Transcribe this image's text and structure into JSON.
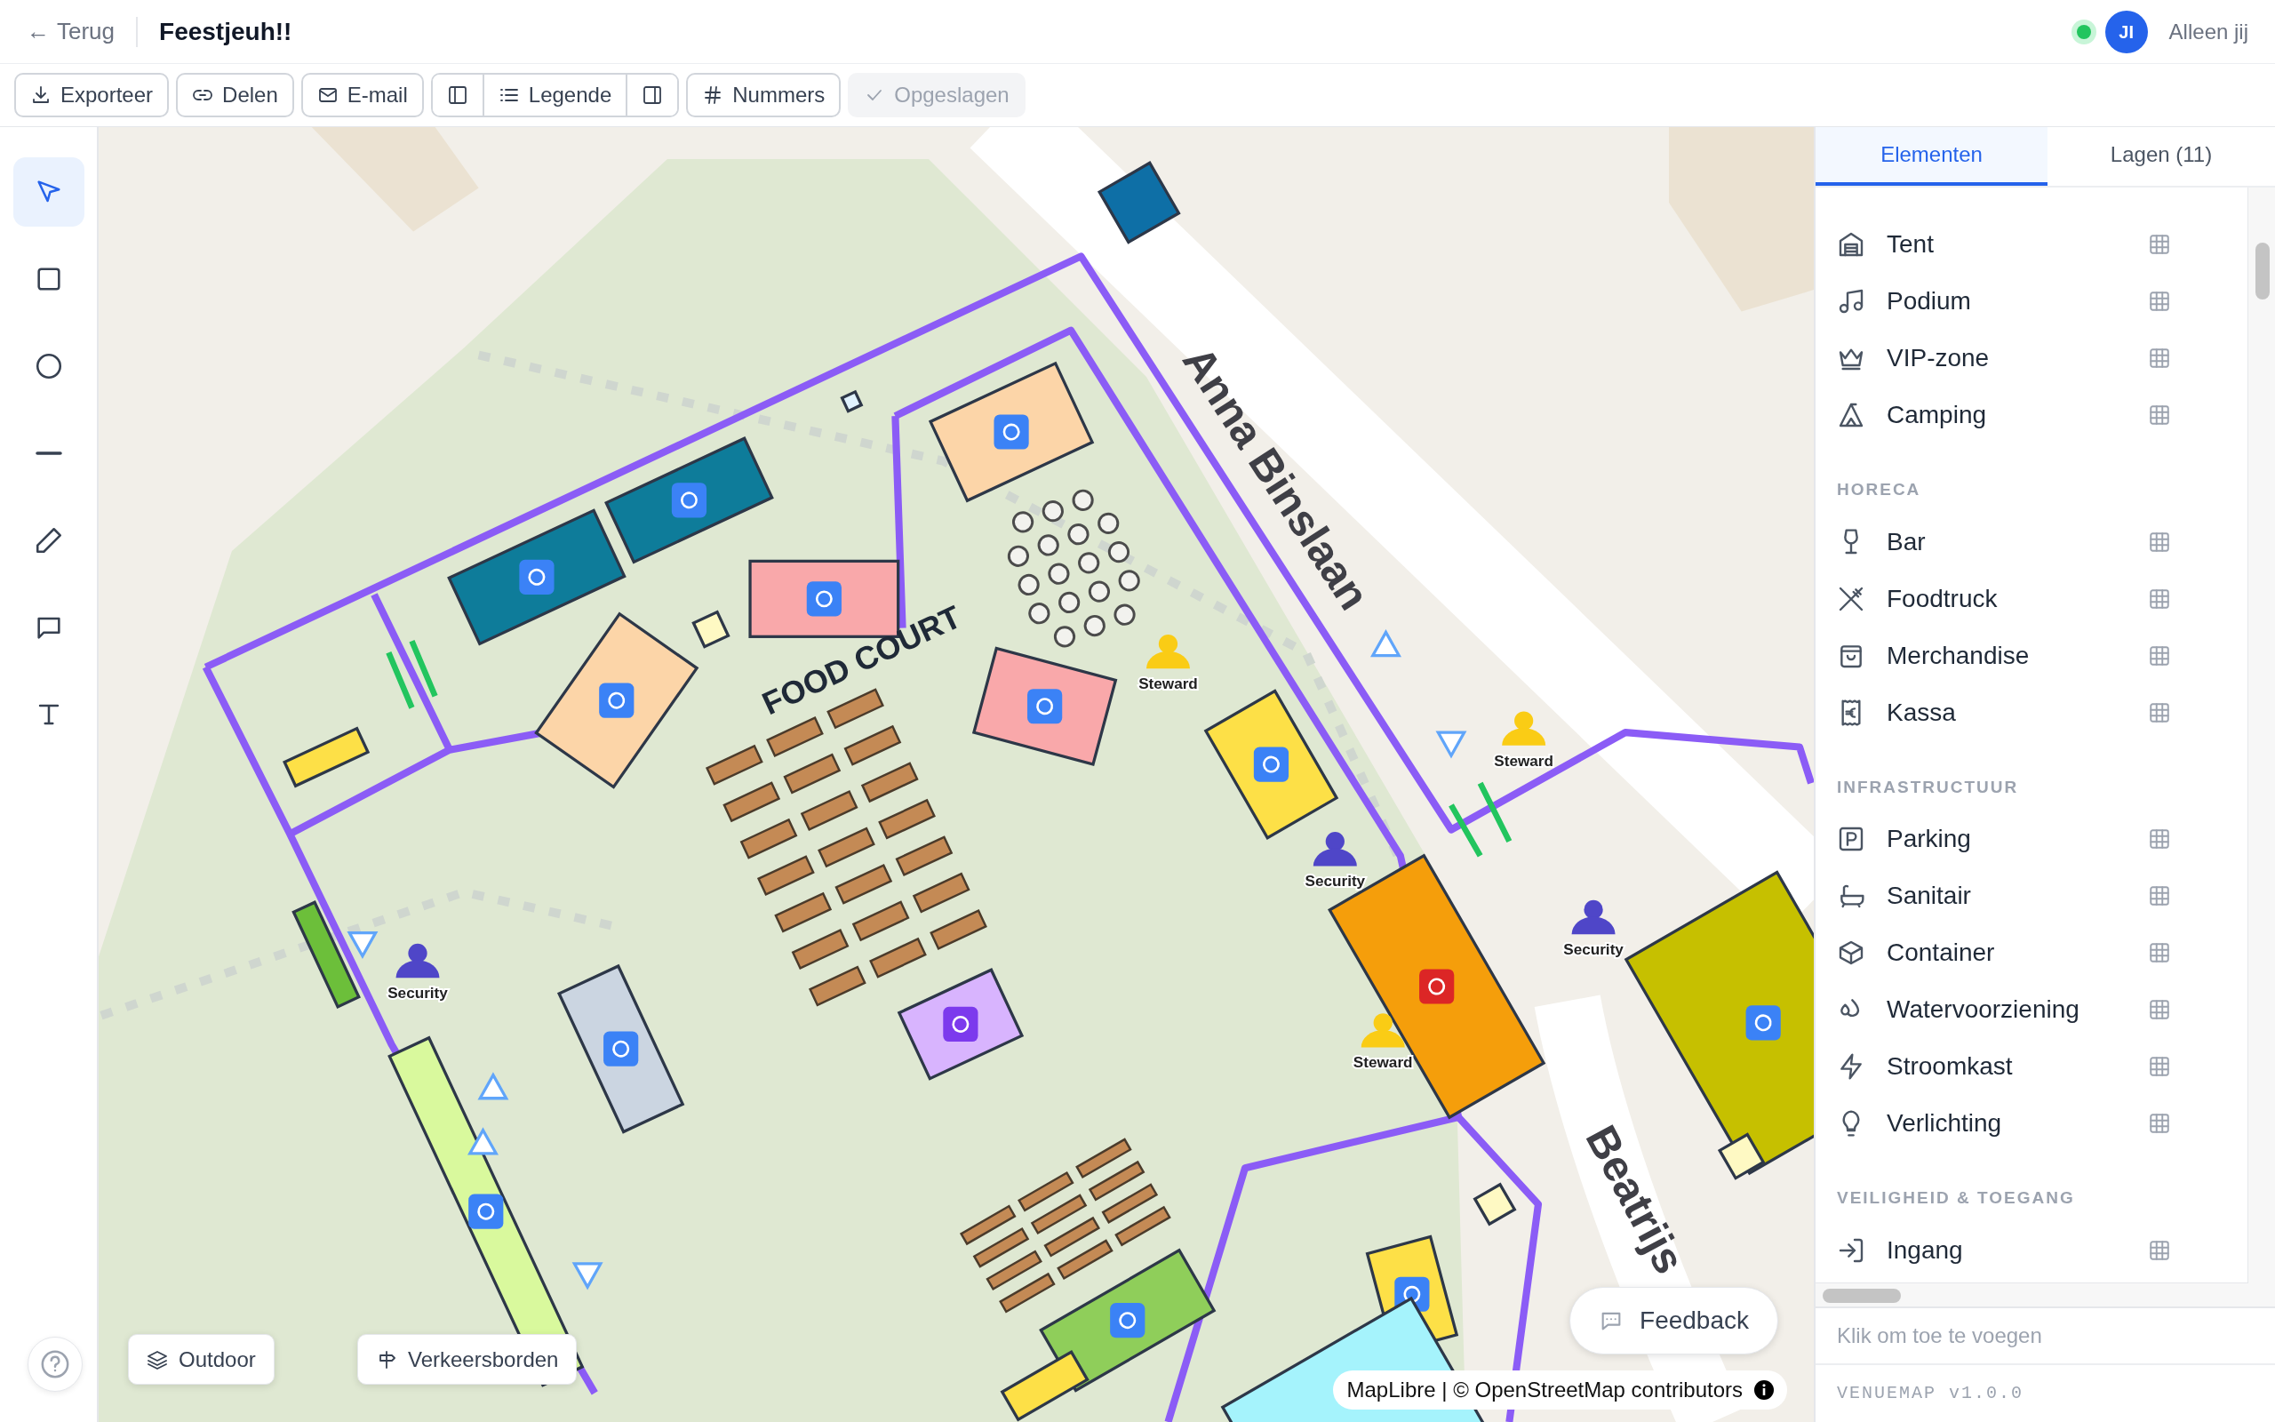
{
  "header": {
    "back": {
      "arrow": "←",
      "label": "Terug"
    },
    "title": "Feestjeuh!!",
    "presence": {
      "online": true,
      "initials": "JI",
      "label": "Alleen jij"
    }
  },
  "toolbar": [
    {
      "kind": "export",
      "label": "Exporteer",
      "disabled": false
    },
    {
      "kind": "share",
      "label": "Delen",
      "disabled": false
    },
    {
      "kind": "email",
      "label": "E-mail",
      "disabled": false
    },
    {
      "kind": "group",
      "items": [
        {
          "kind": "panel-left"
        },
        {
          "kind": "legend",
          "label": "Legende"
        },
        {
          "kind": "panel-right"
        }
      ]
    },
    {
      "kind": "numbers",
      "label": "Nummers",
      "disabled": false
    },
    {
      "kind": "saved",
      "label": "Opgeslagen",
      "disabled": true
    }
  ],
  "tools": [
    {
      "kind": "select",
      "selected": true
    },
    {
      "kind": "rectangle",
      "selected": false
    },
    {
      "kind": "circle",
      "selected": false
    },
    {
      "kind": "line",
      "selected": false
    },
    {
      "kind": "pencil",
      "selected": false
    },
    {
      "kind": "comment",
      "selected": false
    },
    {
      "kind": "text",
      "selected": false
    }
  ],
  "map": {
    "labels": [
      {
        "kind": "street",
        "text": "Anna Binslaan"
      },
      {
        "kind": "area",
        "text": "FOOD COURT"
      },
      {
        "kind": "street",
        "text": "Beatrijs"
      }
    ],
    "markers": [
      {
        "kind": "steward",
        "label": "Steward"
      },
      {
        "kind": "steward",
        "label": "Steward"
      },
      {
        "kind": "security",
        "label": "Security"
      },
      {
        "kind": "security",
        "label": "Security"
      },
      {
        "kind": "security",
        "label": "Security"
      },
      {
        "kind": "steward",
        "label": "Steward"
      }
    ],
    "layer_buttons": [
      {
        "kind": "layers",
        "label": "Outdoor"
      },
      {
        "kind": "signpost",
        "label": "Verkeersborden"
      }
    ],
    "feedback": "Feedback",
    "attribution": "MapLibre | © OpenStreetMap contributors"
  },
  "panel": {
    "tabs": [
      {
        "label": "Elementen",
        "selected": true
      },
      {
        "label": "Lagen (11)",
        "selected": false
      }
    ],
    "sections": [
      {
        "items": [
          {
            "kind": "tent",
            "label": "Tent"
          },
          {
            "kind": "music",
            "label": "Podium"
          },
          {
            "kind": "crown",
            "label": "VIP-zone"
          },
          {
            "kind": "camping",
            "label": "Camping"
          }
        ]
      },
      {
        "title": "HORECA",
        "items": [
          {
            "kind": "wine",
            "label": "Bar"
          },
          {
            "kind": "utensils",
            "label": "Foodtruck"
          },
          {
            "kind": "bag",
            "label": "Merchandise"
          },
          {
            "kind": "receipt",
            "label": "Kassa"
          }
        ]
      },
      {
        "title": "INFRASTRUCTUUR",
        "items": [
          {
            "kind": "parking",
            "label": "Parking"
          },
          {
            "kind": "bath",
            "label": "Sanitair"
          },
          {
            "kind": "box",
            "label": "Container"
          },
          {
            "kind": "droplets",
            "label": "Watervoorziening"
          },
          {
            "kind": "zap",
            "label": "Stroomkast"
          },
          {
            "kind": "bulb",
            "label": "Verlichting"
          }
        ]
      },
      {
        "title": "VEILIGHEID & TOEGANG",
        "items": [
          {
            "kind": "login",
            "label": "Ingang"
          }
        ]
      }
    ],
    "hint": "Klik om toe te voegen",
    "version": "VENUEMAP v1.0.0"
  }
}
